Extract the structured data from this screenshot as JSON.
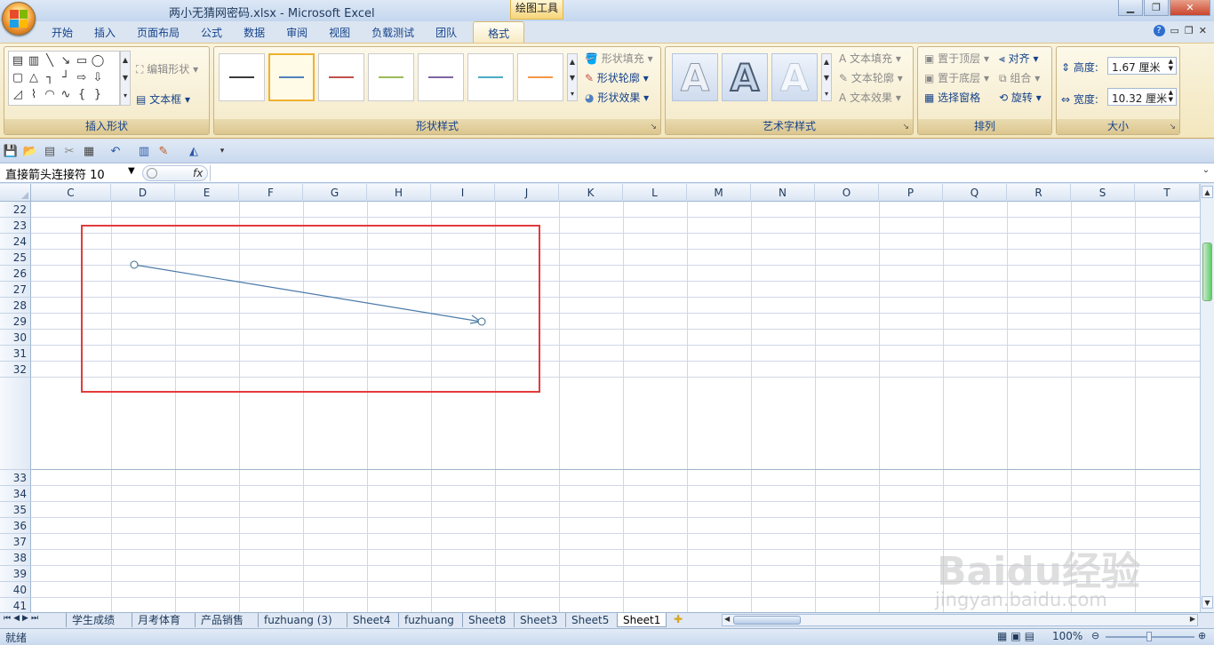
{
  "window": {
    "title": "两小无猜网密码.xlsx - Microsoft Excel",
    "context_tab_group": "绘图工具"
  },
  "tabs": [
    "开始",
    "插入",
    "页面布局",
    "公式",
    "数据",
    "审阅",
    "视图",
    "负载测试",
    "团队",
    "格式"
  ],
  "active_tab": "格式",
  "ribbon": {
    "insert_shapes": {
      "label": "插入形状",
      "edit_shape": "编辑形状",
      "text_box": "文本框"
    },
    "shape_styles": {
      "label": "形状样式",
      "fill": "形状填充",
      "outline": "形状轮廓",
      "effects": "形状效果",
      "swatch_colors": [
        "#3a3a3a",
        "#4f81bd",
        "#c0504d",
        "#9bbb59",
        "#8064a2",
        "#4bacc6",
        "#f79646"
      ]
    },
    "wordart": {
      "label": "艺术字样式",
      "text_fill": "文本填充",
      "text_outline": "文本轮廓",
      "text_effects": "文本效果",
      "letter": "A"
    },
    "arrange": {
      "label": "排列",
      "bring_front": "置于顶层",
      "send_back": "置于底层",
      "selection_pane": "选择窗格",
      "align": "对齐",
      "group": "组合",
      "rotate": "旋转"
    },
    "size": {
      "label": "大小",
      "height_label": "高度:",
      "height_value": "1.67 厘米",
      "width_label": "宽度:",
      "width_value": "10.32 厘米"
    }
  },
  "formula_bar": {
    "name_box": "直接箭头连接符 10",
    "fx": "fx"
  },
  "columns": [
    "C",
    "D",
    "E",
    "F",
    "G",
    "H",
    "I",
    "J",
    "K",
    "L",
    "M",
    "N",
    "O",
    "P",
    "Q",
    "R",
    "S",
    "T"
  ],
  "rows_top": [
    "22",
    "23",
    "24",
    "25",
    "26",
    "27",
    "28",
    "29",
    "30",
    "31",
    "32"
  ],
  "rows_bottom": [
    "33",
    "34",
    "35",
    "36",
    "37",
    "38",
    "39",
    "40",
    "41"
  ],
  "sheet_tabs": [
    "学生成绩",
    "月考体育",
    "产品销售",
    "fuzhuang (3)",
    "Sheet4",
    "fuzhuang",
    "Sheet8",
    "Sheet3",
    "Sheet5",
    "Sheet1"
  ],
  "active_sheet": "Sheet1",
  "status": {
    "ready": "就绪",
    "zoom": "100%"
  },
  "watermark": {
    "brand": "Baidu经验",
    "url": "jingyan.baidu.com"
  },
  "colors": {
    "connector_line": "#4a7aa8",
    "highlight_box": "#e23b3b",
    "active_tab_bg": "#fbeec6"
  }
}
